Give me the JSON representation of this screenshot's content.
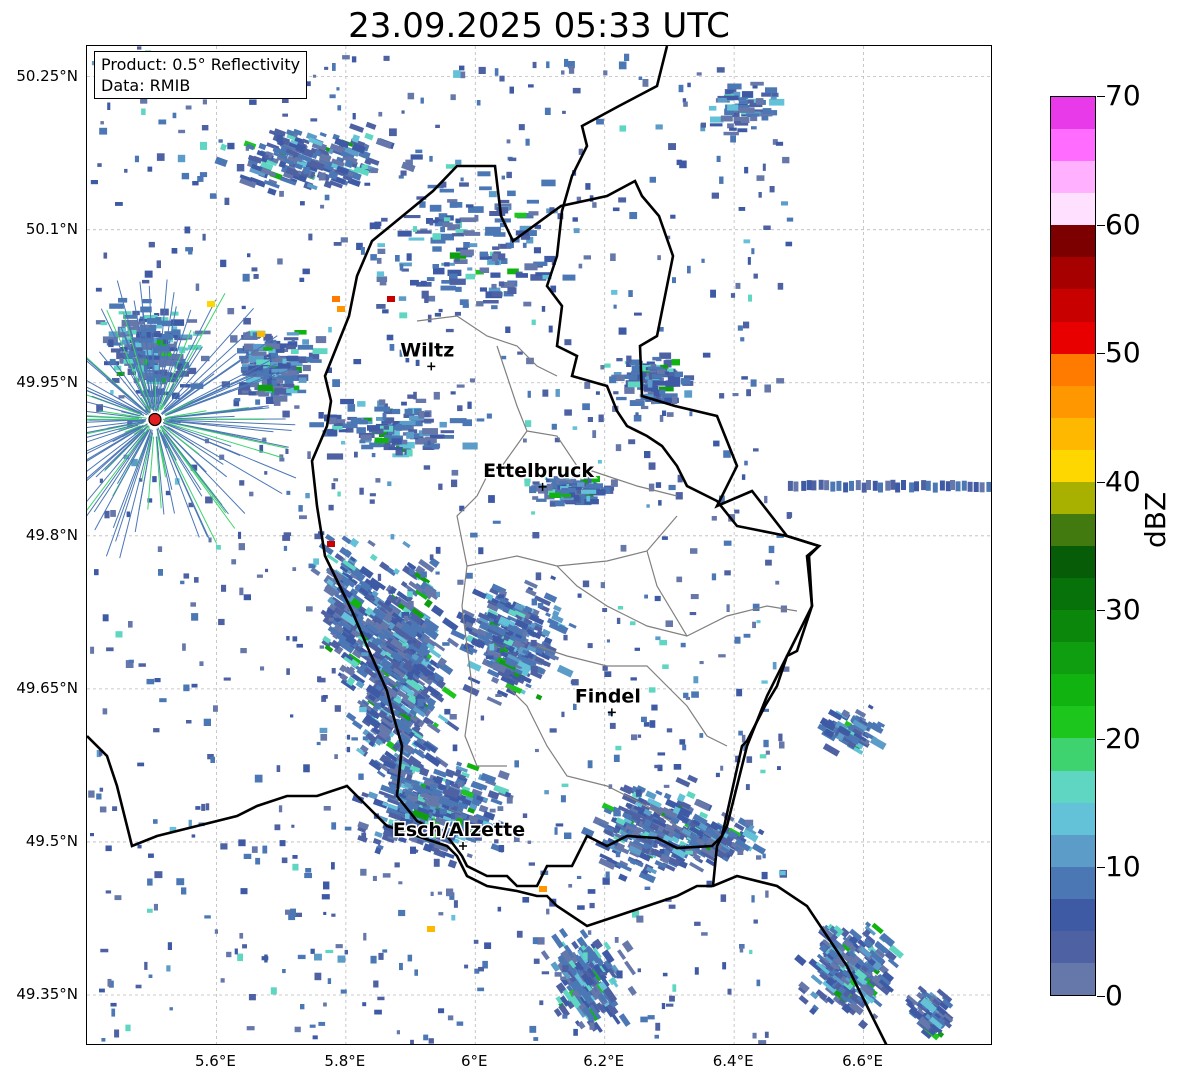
{
  "title": "23.09.2025 05:33 UTC",
  "info": {
    "product": "Product: 0.5° Reflectivity",
    "data": "Data: RMIB"
  },
  "map": {
    "lon_range": [
      5.4,
      6.8
    ],
    "lat_range": [
      49.3,
      50.28
    ],
    "lat_ticks": [
      {
        "value": 50.25,
        "label": "50.25°N"
      },
      {
        "value": 50.1,
        "label": "50.1°N"
      },
      {
        "value": 49.95,
        "label": "49.95°N"
      },
      {
        "value": 49.8,
        "label": "49.8°N"
      },
      {
        "value": 49.65,
        "label": "49.65°N"
      },
      {
        "value": 49.5,
        "label": "49.5°N"
      },
      {
        "value": 49.35,
        "label": "49.35°N"
      }
    ],
    "lon_ticks": [
      {
        "value": 5.6,
        "label": "5.6°E"
      },
      {
        "value": 5.8,
        "label": "5.8°E"
      },
      {
        "value": 6.0,
        "label": "6°E"
      },
      {
        "value": 6.2,
        "label": "6.2°E"
      },
      {
        "value": 6.4,
        "label": "6.4°E"
      },
      {
        "value": 6.6,
        "label": "6.6°E"
      }
    ],
    "cities": [
      {
        "name": "Wiltz",
        "lon": 5.932,
        "lat": 49.966
      },
      {
        "name": "Ettelbruck",
        "lon": 6.104,
        "lat": 49.848
      },
      {
        "name": "Findel",
        "lon": 6.211,
        "lat": 49.627
      },
      {
        "name": "Esch/Alzette",
        "lon": 5.981,
        "lat": 49.496
      }
    ],
    "radar_site": {
      "lon": 5.505,
      "lat": 49.914
    },
    "colors": {
      "country_border": "#000000",
      "canton_border": "#808080",
      "radar_site": "#e02020"
    }
  },
  "colorbar": {
    "label": "dBZ",
    "min": 0,
    "max": 70,
    "ticks": [
      {
        "value": 0,
        "label": "0"
      },
      {
        "value": 10,
        "label": "10"
      },
      {
        "value": 20,
        "label": "20"
      },
      {
        "value": 30,
        "label": "30"
      },
      {
        "value": 40,
        "label": "40"
      },
      {
        "value": 50,
        "label": "50"
      },
      {
        "value": 60,
        "label": "60"
      },
      {
        "value": 70,
        "label": "70"
      }
    ],
    "colors": [
      "#6677aa",
      "#4d61a3",
      "#3f5aa5",
      "#4b77b5",
      "#5c9cc8",
      "#63c1d8",
      "#5fd6c2",
      "#3ed36e",
      "#1cc61c",
      "#11b311",
      "#0f9e0f",
      "#0b880b",
      "#08720a",
      "#075c07",
      "#437a10",
      "#a8b000",
      "#ffd700",
      "#ffb800",
      "#ff9800",
      "#ff7b00",
      "#e80000",
      "#c80000",
      "#a60000",
      "#7d0000",
      "#ffe1ff",
      "#ffb0ff",
      "#ff6cff",
      "#e83ae8"
    ]
  }
}
